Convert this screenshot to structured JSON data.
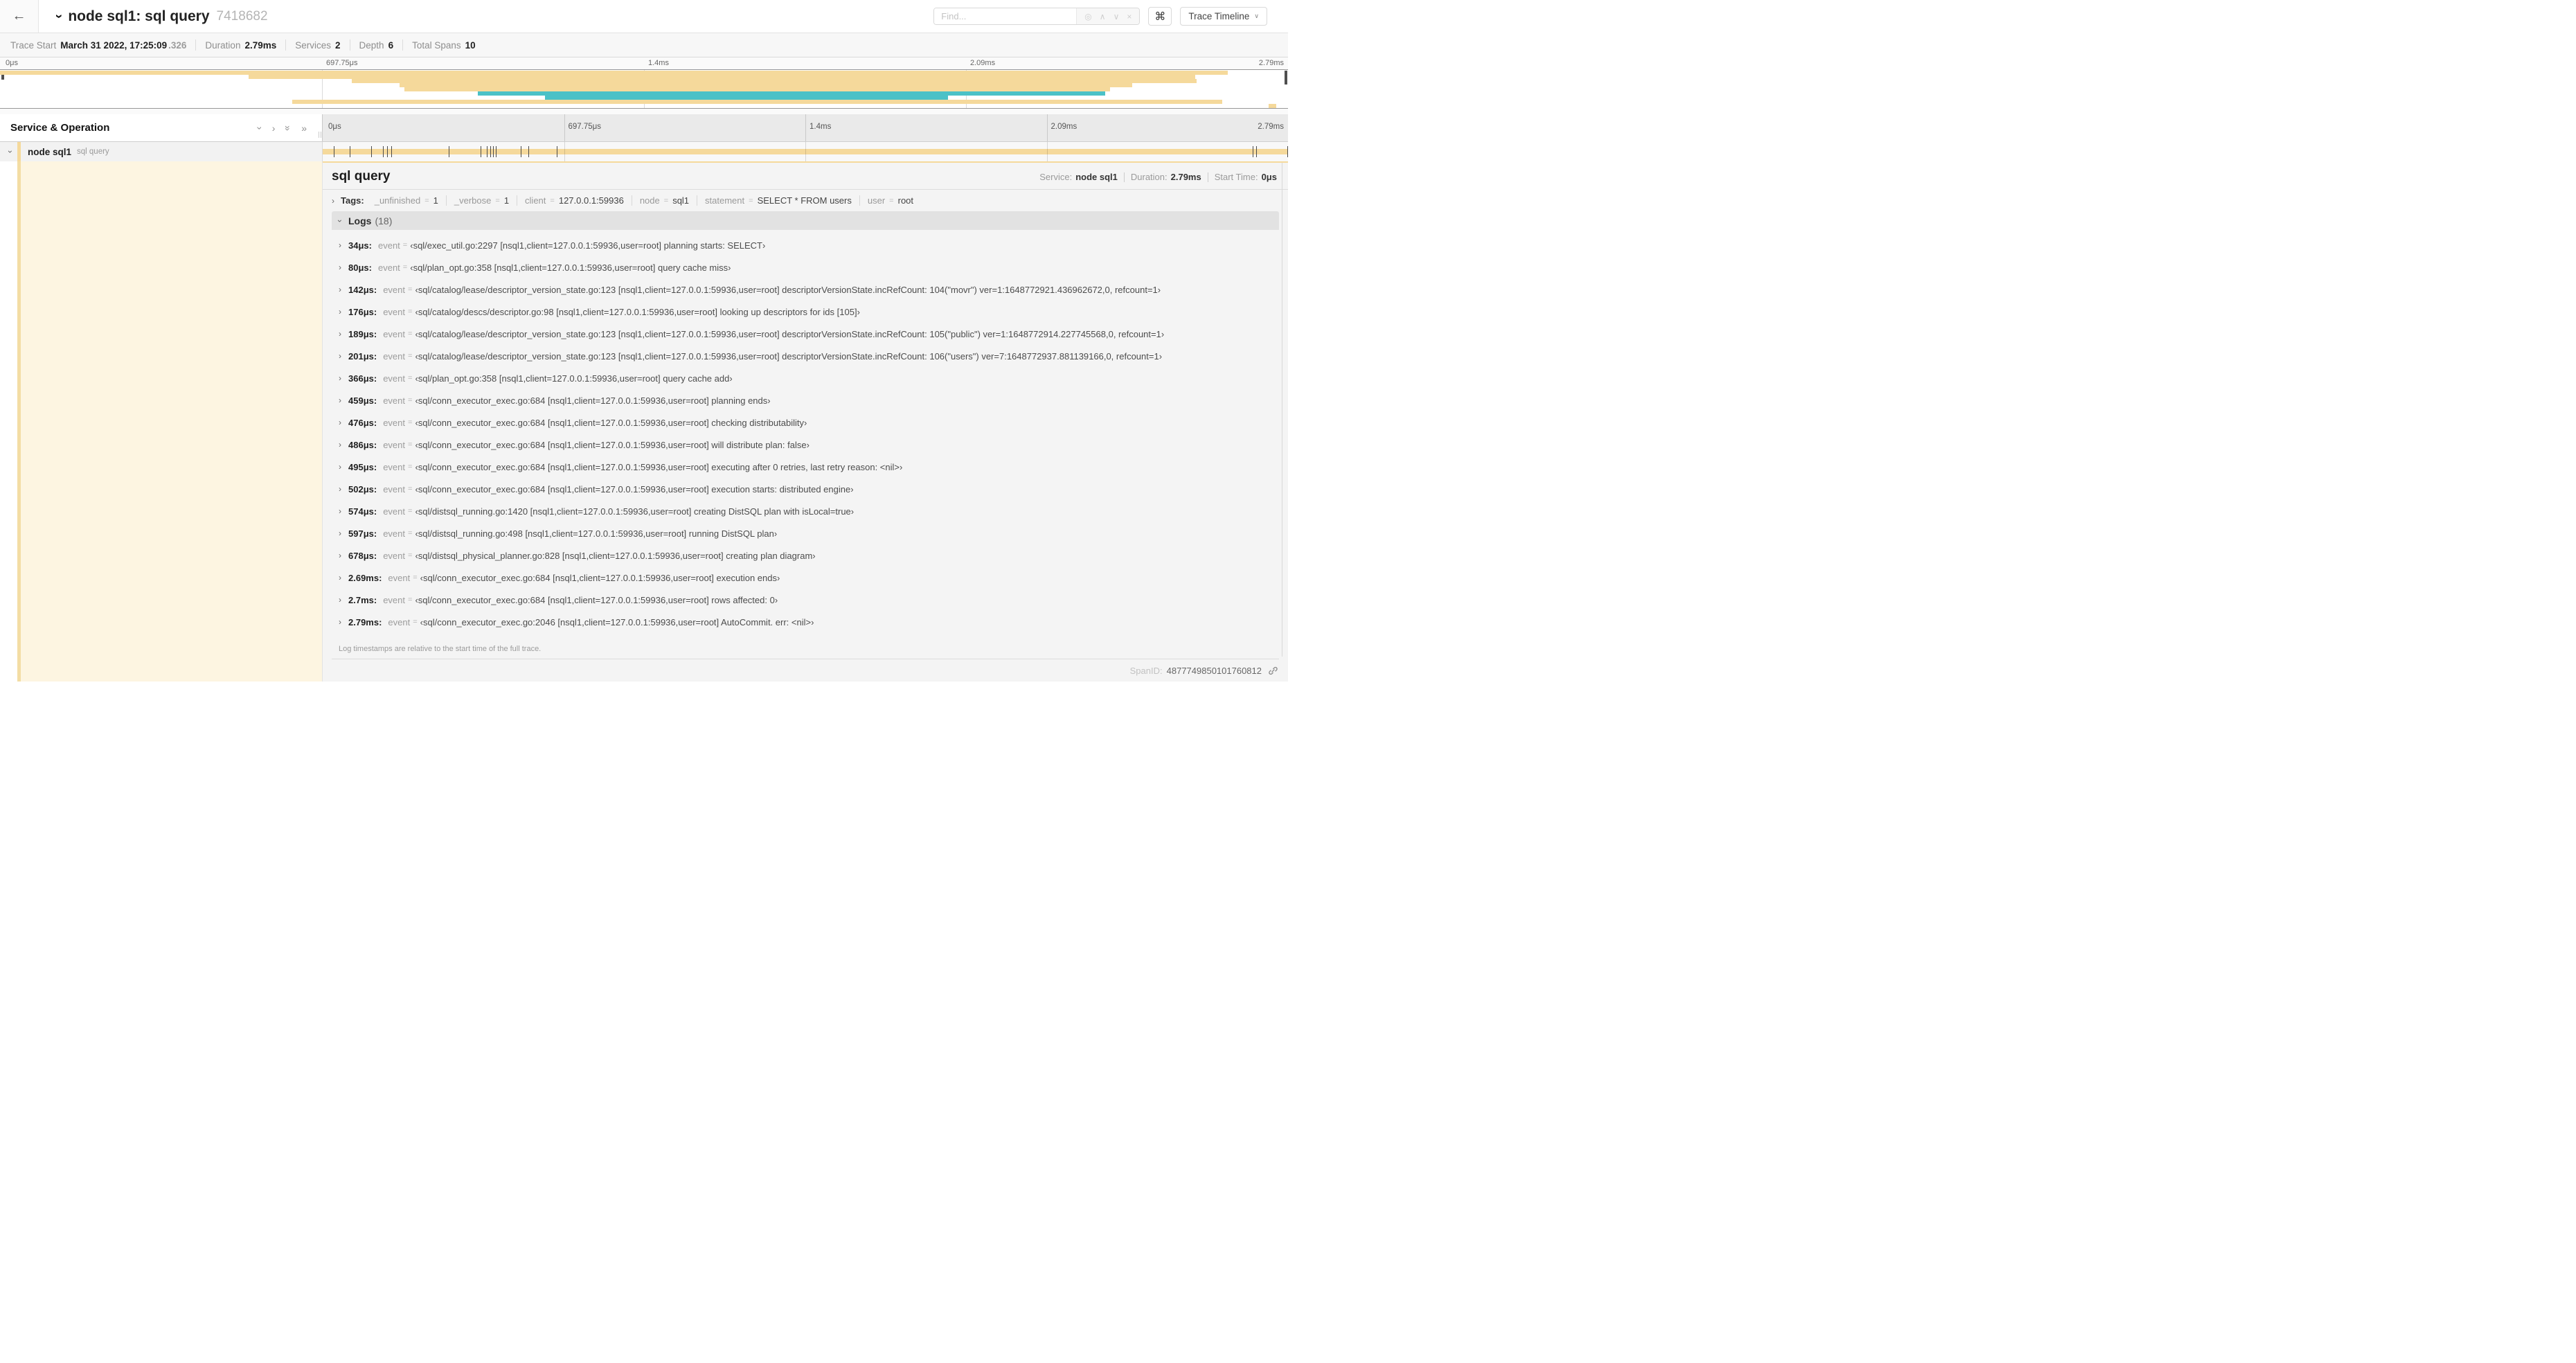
{
  "colors": {
    "span_tan": "#f5d99b",
    "span_teal": "#4bc1c7",
    "row_tint": "#fdf5e1",
    "indent_stripe": "#f3dda4"
  },
  "header": {
    "back_icon": "←",
    "title": "node sql1: sql query",
    "trace_id_short": "7418682",
    "find_placeholder": "Find...",
    "shortcut_glyph": "⌘",
    "view_selector": "Trace Timeline"
  },
  "summary": {
    "items": [
      {
        "label": "Trace Start",
        "value": "March 31 2022, 17:25:09",
        "suffix": ".326"
      },
      {
        "label": "Duration",
        "value": "2.79ms"
      },
      {
        "label": "Services",
        "value": "2"
      },
      {
        "label": "Depth",
        "value": "6"
      },
      {
        "label": "Total Spans",
        "value": "10"
      }
    ]
  },
  "timeline": {
    "tick_labels": [
      "0μs",
      "697.75μs",
      "1.4ms",
      "2.09ms",
      "2.79ms"
    ],
    "left_header": "Service & Operation",
    "row": {
      "service": "node sql1",
      "operation": "sql query"
    }
  },
  "minimap": {
    "rows": [
      {
        "s": 0.0,
        "e": 0.953,
        "c": "span_tan"
      },
      {
        "s": 0.193,
        "e": 0.928,
        "c": "span_tan"
      },
      {
        "s": 0.273,
        "e": 0.929,
        "c": "span_tan"
      },
      {
        "s": 0.31,
        "e": 0.879,
        "c": "span_tan"
      },
      {
        "s": 0.314,
        "e": 0.862,
        "c": "span_tan"
      },
      {
        "s": 0.371,
        "e": 0.858,
        "c": "span_teal"
      },
      {
        "s": 0.423,
        "e": 0.736,
        "c": "span_teal"
      },
      {
        "s": 0.227,
        "e": 0.949,
        "c": "span_tan"
      },
      {
        "s": 0.985,
        "e": 0.991,
        "c": "span_tan"
      }
    ]
  },
  "trace": {
    "duration_us": 2790
  },
  "detail": {
    "operation": "sql query",
    "meta": [
      {
        "label": "Service:",
        "value": "node sql1"
      },
      {
        "label": "Duration:",
        "value": "2.79ms"
      },
      {
        "label": "Start Time:",
        "value": "0μs"
      }
    ],
    "tags_label": "Tags:",
    "tags": [
      {
        "key": "_unfinished",
        "value": "1"
      },
      {
        "key": "_verbose",
        "value": "1"
      },
      {
        "key": "client",
        "value": "127.0.0.1:59936"
      },
      {
        "key": "node",
        "value": "sql1"
      },
      {
        "key": "statement",
        "value": "SELECT * FROM users"
      },
      {
        "key": "user",
        "value": "root"
      }
    ],
    "logs_label": "Logs",
    "logs_count": "(18)",
    "log_field_key": "event",
    "logs": [
      {
        "t_us": 34,
        "t": "34μs:",
        "value": "‹sql/exec_util.go:2297 [nsql1,client=127.0.0.1:59936,user=root] planning starts: SELECT›"
      },
      {
        "t_us": 80,
        "t": "80μs:",
        "value": "‹sql/plan_opt.go:358 [nsql1,client=127.0.0.1:59936,user=root] query cache miss›"
      },
      {
        "t_us": 142,
        "t": "142μs:",
        "value": "‹sql/catalog/lease/descriptor_version_state.go:123 [nsql1,client=127.0.0.1:59936,user=root] descriptorVersionState.incRefCount: 104(\"movr\") ver=1:1648772921.436962672,0, refcount=1›"
      },
      {
        "t_us": 176,
        "t": "176μs:",
        "value": "‹sql/catalog/descs/descriptor.go:98 [nsql1,client=127.0.0.1:59936,user=root] looking up descriptors for ids [105]›"
      },
      {
        "t_us": 189,
        "t": "189μs:",
        "value": "‹sql/catalog/lease/descriptor_version_state.go:123 [nsql1,client=127.0.0.1:59936,user=root] descriptorVersionState.incRefCount: 105(\"public\") ver=1:1648772914.227745568,0, refcount=1›"
      },
      {
        "t_us": 201,
        "t": "201μs:",
        "value": "‹sql/catalog/lease/descriptor_version_state.go:123 [nsql1,client=127.0.0.1:59936,user=root] descriptorVersionState.incRefCount: 106(\"users\") ver=7:1648772937.881139166,0, refcount=1›"
      },
      {
        "t_us": 366,
        "t": "366μs:",
        "value": "‹sql/plan_opt.go:358 [nsql1,client=127.0.0.1:59936,user=root] query cache add›"
      },
      {
        "t_us": 459,
        "t": "459μs:",
        "value": "‹sql/conn_executor_exec.go:684 [nsql1,client=127.0.0.1:59936,user=root] planning ends›"
      },
      {
        "t_us": 476,
        "t": "476μs:",
        "value": "‹sql/conn_executor_exec.go:684 [nsql1,client=127.0.0.1:59936,user=root] checking distributability›"
      },
      {
        "t_us": 486,
        "t": "486μs:",
        "value": "‹sql/conn_executor_exec.go:684 [nsql1,client=127.0.0.1:59936,user=root] will distribute plan: false›"
      },
      {
        "t_us": 495,
        "t": "495μs:",
        "value": "‹sql/conn_executor_exec.go:684 [nsql1,client=127.0.0.1:59936,user=root] executing after 0 retries, last retry reason: <nil>›"
      },
      {
        "t_us": 502,
        "t": "502μs:",
        "value": "‹sql/conn_executor_exec.go:684 [nsql1,client=127.0.0.1:59936,user=root] execution starts: distributed engine›"
      },
      {
        "t_us": 574,
        "t": "574μs:",
        "value": "‹sql/distsql_running.go:1420 [nsql1,client=127.0.0.1:59936,user=root] creating DistSQL plan with isLocal=true›"
      },
      {
        "t_us": 597,
        "t": "597μs:",
        "value": "‹sql/distsql_running.go:498 [nsql1,client=127.0.0.1:59936,user=root] running DistSQL plan›"
      },
      {
        "t_us": 678,
        "t": "678μs:",
        "value": "‹sql/distsql_physical_planner.go:828 [nsql1,client=127.0.0.1:59936,user=root] creating plan diagram›"
      },
      {
        "t_us": 2690,
        "t": "2.69ms:",
        "value": "‹sql/conn_executor_exec.go:684 [nsql1,client=127.0.0.1:59936,user=root] execution ends›"
      },
      {
        "t_us": 2700,
        "t": "2.7ms:",
        "value": "‹sql/conn_executor_exec.go:684 [nsql1,client=127.0.0.1:59936,user=root] rows affected: 0›"
      },
      {
        "t_us": 2790,
        "t": "2.79ms:",
        "value": "‹sql/conn_executor_exec.go:2046 [nsql1,client=127.0.0.1:59936,user=root] AutoCommit. err: <nil>›"
      }
    ],
    "note": "Log timestamps are relative to the start time of the full trace.",
    "span_id_label": "SpanID:",
    "span_id": "4877749850101760812"
  }
}
